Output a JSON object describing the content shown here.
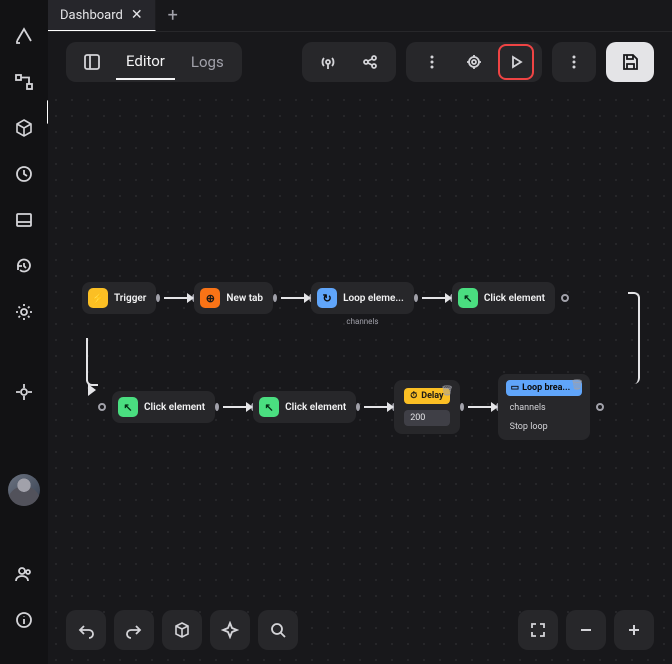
{
  "tabs": {
    "active": "Dashboard"
  },
  "toolbar": {
    "editor": "Editor",
    "logs": "Logs"
  },
  "rail": [
    "logo",
    "flow",
    "package",
    "clock",
    "monitor",
    "history",
    "settings",
    "",
    "target",
    "",
    "avatar",
    "",
    "users",
    "info"
  ],
  "nodes": {
    "row1": [
      {
        "label": "Trigger",
        "color": "#fbbf24",
        "glyph": "⚡"
      },
      {
        "label": "New tab",
        "color": "#f97316",
        "glyph": "⊕"
      },
      {
        "label": "Loop eleme...",
        "color": "#60a5fa",
        "glyph": "↻",
        "sub": "channels"
      },
      {
        "label": "Click element",
        "color": "#4ade80",
        "glyph": "↖"
      }
    ],
    "row2": [
      {
        "label": "Click element",
        "color": "#4ade80",
        "glyph": "↖"
      },
      {
        "label": "Click element",
        "color": "#4ade80",
        "glyph": "↖"
      }
    ],
    "delay": {
      "title": "Delay",
      "value": "200"
    },
    "loopCard": {
      "title": "Loop brea...",
      "items": [
        "channels",
        "Stop loop"
      ]
    }
  },
  "icons": {
    "logo": "◬",
    "flow": "⇄",
    "package": "⬚",
    "clock": "◷",
    "monitor": "▭",
    "history": "↺",
    "settings": "⚙",
    "target": "⌖",
    "users": "👥",
    "info": "ⓘ",
    "panel": "▣",
    "broadcast": "◈",
    "share": "⟲",
    "dots": "⋮",
    "bug": "⬡",
    "play": "▷",
    "save": "⬓",
    "undo": "↶",
    "redo": "↷",
    "cube": "⬚",
    "star": "✧",
    "search": "◯",
    "fs": "⛶",
    "minus": "−",
    "plus": "+"
  }
}
